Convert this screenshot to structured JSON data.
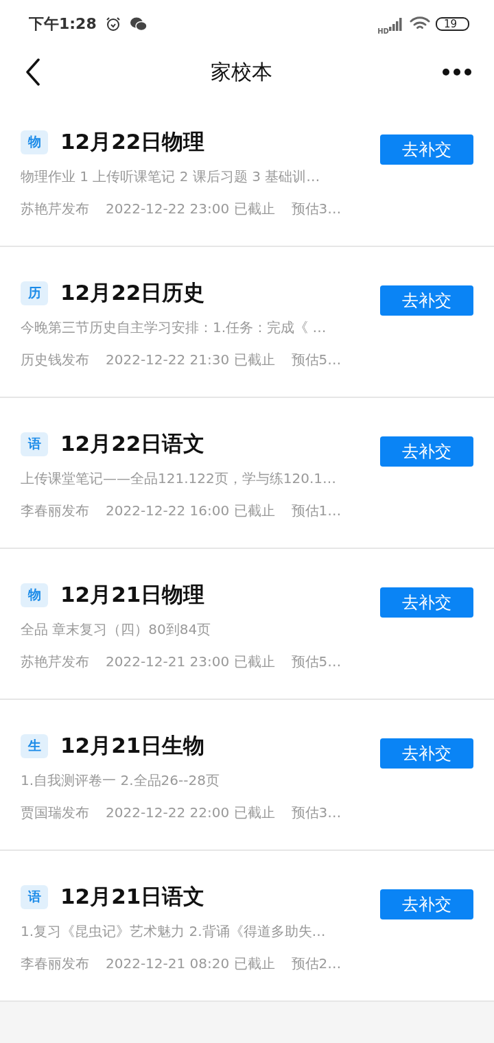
{
  "status_bar": {
    "time": "下午1:28",
    "signal_label": "HD",
    "battery": "19"
  },
  "header": {
    "title": "家校本"
  },
  "assignments": [
    {
      "subject": "物",
      "title": "12月22日物理",
      "description": "物理作业 1 上传听课笔记 2 课后习题 3 基础训…",
      "publisher": "苏艳芹发布",
      "deadline": "2022-12-22 23:00 已截止",
      "estimate": "预估3…",
      "action": "去补交"
    },
    {
      "subject": "历",
      "title": "12月22日历史",
      "description": "今晚第三节历史自主学习安排：1.任务：完成《 …",
      "publisher": "历史钱发布",
      "deadline": "2022-12-22 21:30 已截止",
      "estimate": "预估5…",
      "action": "去补交"
    },
    {
      "subject": "语",
      "title": "12月22日语文",
      "description": "上传课堂笔记——全品121.122页，学与练120.1…",
      "publisher": "李春丽发布",
      "deadline": "2022-12-22 16:00 已截止",
      "estimate": "预估1…",
      "action": "去补交"
    },
    {
      "subject": "物",
      "title": "12月21日物理",
      "description": "全品 章末复习（四）80到84页",
      "publisher": "苏艳芹发布",
      "deadline": "2022-12-21 23:00 已截止",
      "estimate": "预估5…",
      "action": "去补交"
    },
    {
      "subject": "生",
      "title": "12月21日生物",
      "description": "1.自我测评卷一 2.全品26--28页",
      "publisher": "贾国瑞发布",
      "deadline": "2022-12-22 22:00 已截止",
      "estimate": "预估3…",
      "action": "去补交"
    },
    {
      "subject": "语",
      "title": "12月21日语文",
      "description": "1.复习《昆虫记》艺术魅力 2.背诵《得道多助失…",
      "publisher": "李春丽发布",
      "deadline": "2022-12-21 08:20 已截止",
      "estimate": "预估2…",
      "action": "去补交"
    }
  ]
}
